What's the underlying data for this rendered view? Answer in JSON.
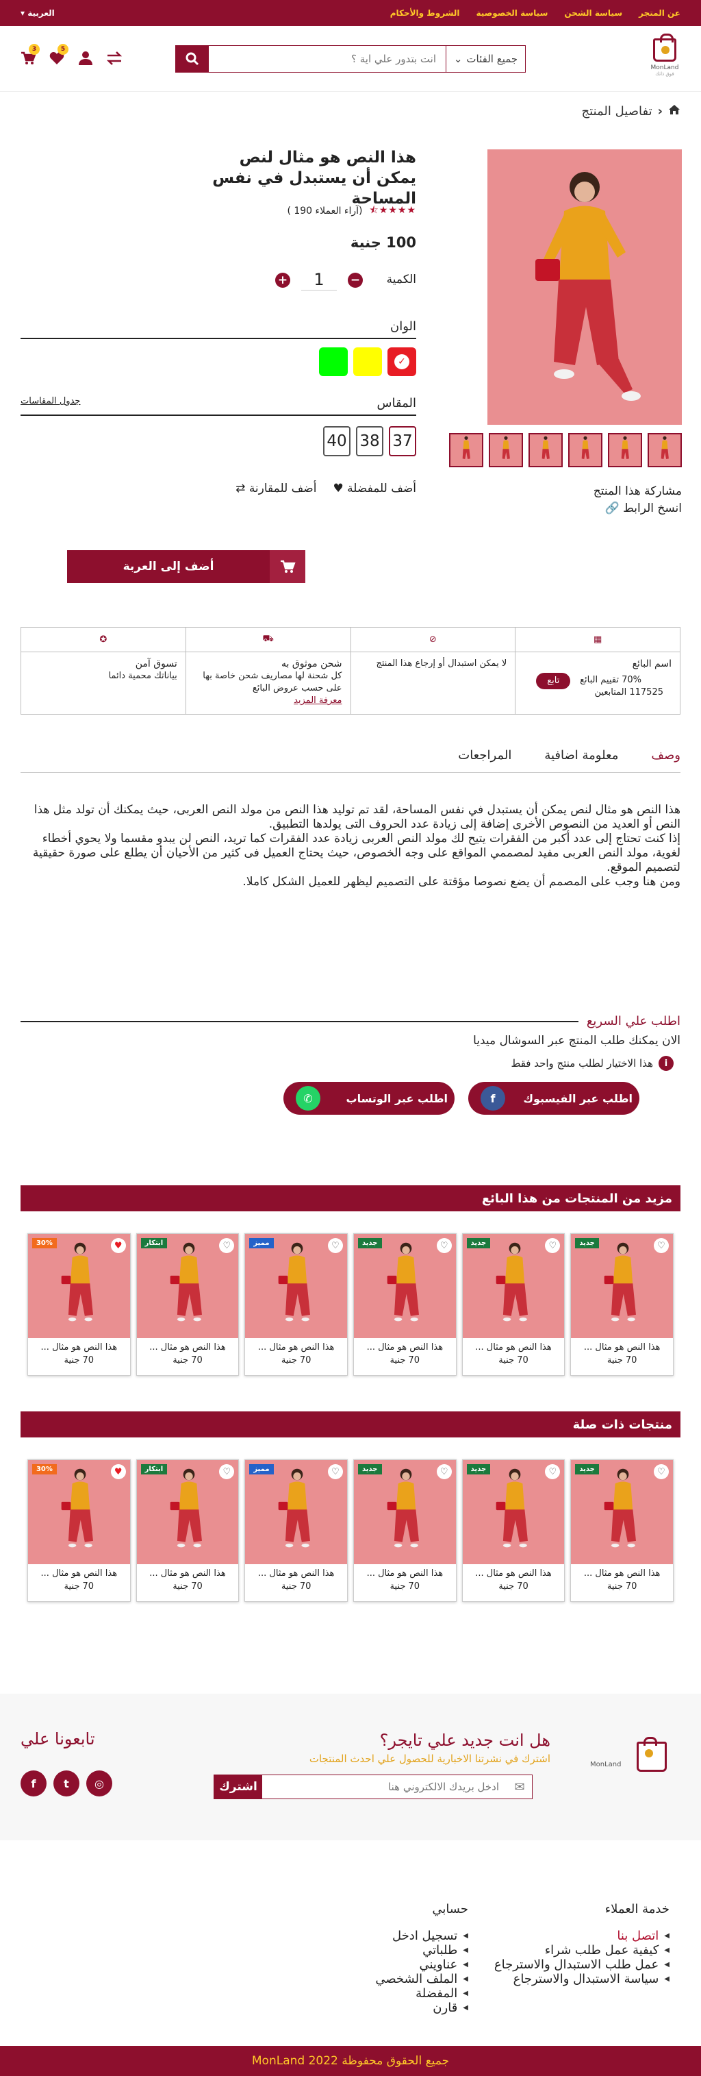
{
  "topbar": {
    "links": [
      "عن المتجر",
      "سياسة الشحن",
      "سياسة الخصوصية",
      "الشروط والأحكام"
    ],
    "language": "العربية"
  },
  "header": {
    "logo_name": "MonLand",
    "logo_tagline": "فوق ذاتك",
    "category_select": "جميع الفئات",
    "search_placeholder": "انت بتدور علي اية ؟",
    "wishlist_count": "5",
    "cart_count": "3"
  },
  "breadcrumb": "تفاصيل المنتج",
  "product": {
    "title": "هذا النص هو مثال لنص يمكن أن يستبدل في نفس المساحة",
    "rating_text": "(آراء العملاء 190 )",
    "stars": 4.5,
    "price": "100 جنية",
    "qty_label": "الكمية",
    "qty": "1",
    "colors_label": "الوان",
    "colors": [
      "#e81c24",
      "#ffff00",
      "#00ff00"
    ],
    "sizes_label": "المقاس",
    "size_chart": "جدول المقاسات",
    "sizes": [
      "37",
      "38",
      "40"
    ],
    "share_label": "مشاركة هذا المنتج",
    "copy_link": "انسخ الرابط",
    "add_favorite": "أضف للمفضلة",
    "add_compare": "أضف للمقارنة",
    "add_cart": "أضف إلى العربة"
  },
  "features": {
    "seller_name": "اسم البائع",
    "seller_rating": "70% تقييم البائع",
    "seller_followers": "117525 المتابعين",
    "follow_btn": "تابع",
    "returns": "لا يمكن استبدال أو إرجاع هذا المنتج",
    "shipping_title": "شحن موثوق به",
    "shipping_text": "كل شحنة لها مصاريف شحن خاصة بها على حسب عروض البائع",
    "learn_more": "معرفة المزيد",
    "secure_title": "تسوق آمن",
    "secure_text": "بياناتك محمية دائما"
  },
  "tabs": [
    "وصف",
    "معلومة اضافية",
    "المراجعات"
  ],
  "description": [
    "هذا النص هو مثال لنص يمكن أن يستبدل في نفس المساحة، لقد تم توليد هذا النص من مولد النص العربى، حيث يمكنك أن تولد مثل هذا النص أو العديد من النصوص الأخرى إضافة إلى زيادة عدد الحروف التى يولدها التطبيق.",
    "إذا كنت تحتاج إلى عدد أكبر من الفقرات يتيح لك مولد النص العربى زيادة عدد الفقرات كما تريد، النص لن يبدو مقسما ولا يحوي أخطاء لغوية، مولد النص العربى مفيد لمصممي المواقع على وجه الخصوص، حيث يحتاج العميل فى كثير من الأحيان أن يطلع على صورة حقيقية لتصميم الموقع.",
    "ومن هنا وجب على المصمم أن يضع نصوصا مؤقتة على التصميم ليظهر للعميل الشكل كاملا."
  ],
  "quick_order": {
    "title": "اطلب علي السريع",
    "subtitle": "الان يمكنك طلب المنتج عبر السوشال ميديا",
    "note": "هذا الاختيار لطلب منتج واحد فقط",
    "facebook": "اطلب عبر الفيسبوك",
    "whatsapp": "اطلب عبر الوتساب"
  },
  "sections": {
    "seller_more": "مزيد من المنتجات من هذا البائع",
    "related": "منتجات ذات صلة"
  },
  "products": [
    {
      "name": "هذا النص هو مثال ...",
      "price": "70 جنية",
      "tag": "جديد",
      "tag_color": "#1b7a3d",
      "liked": false
    },
    {
      "name": "هذا النص هو مثال ...",
      "price": "70 جنية",
      "tag": "جديد",
      "tag_color": "#1b7a3d",
      "liked": false
    },
    {
      "name": "هذا النص هو مثال ...",
      "price": "70 جنية",
      "tag": "جديد",
      "tag_color": "#1b7a3d",
      "liked": false
    },
    {
      "name": "هذا النص هو مثال ...",
      "price": "70 جنية",
      "tag": "مميز",
      "tag_color": "#2462c9",
      "liked": false
    },
    {
      "name": "هذا النص هو مثال ...",
      "price": "70 جنية",
      "tag": "ابتكار",
      "tag_color": "#1b7a3d",
      "liked": false
    },
    {
      "name": "هذا النص هو مثال ...",
      "price": "70 جنية",
      "tag": "30%",
      "tag_color": "#f26b1d",
      "liked": true
    }
  ],
  "newsletter": {
    "title": "هل انت جديد علي تايجر؟",
    "subtitle": "اشترك في نشرتنا الاخبارية للحصول علي احدث المنتجات",
    "placeholder": "ادخل بريدك الالكتروني هنا",
    "button": "اشترك",
    "follow": "تابعونا علي"
  },
  "footer": {
    "customer_title": "خدمة العملاء",
    "customer_links": [
      "اتصل بنا",
      "كيفية عمل طلب شراء",
      "عمل طلب الاستبدال والاسترجاع",
      "سياسة الاستبدال والاسترجاع"
    ],
    "account_title": "حسابي",
    "account_links": [
      "تسجيل ادخل",
      "طلباتي",
      "عناويني",
      "الملف الشخصي",
      "المفضلة",
      "قارن"
    ],
    "copyright": "جميع الحقوق محفوظة  MonLand 2022"
  },
  "colors": {
    "brand": "#8d0f2d",
    "accent": "#ffc928",
    "gold": "#e2a31c"
  }
}
